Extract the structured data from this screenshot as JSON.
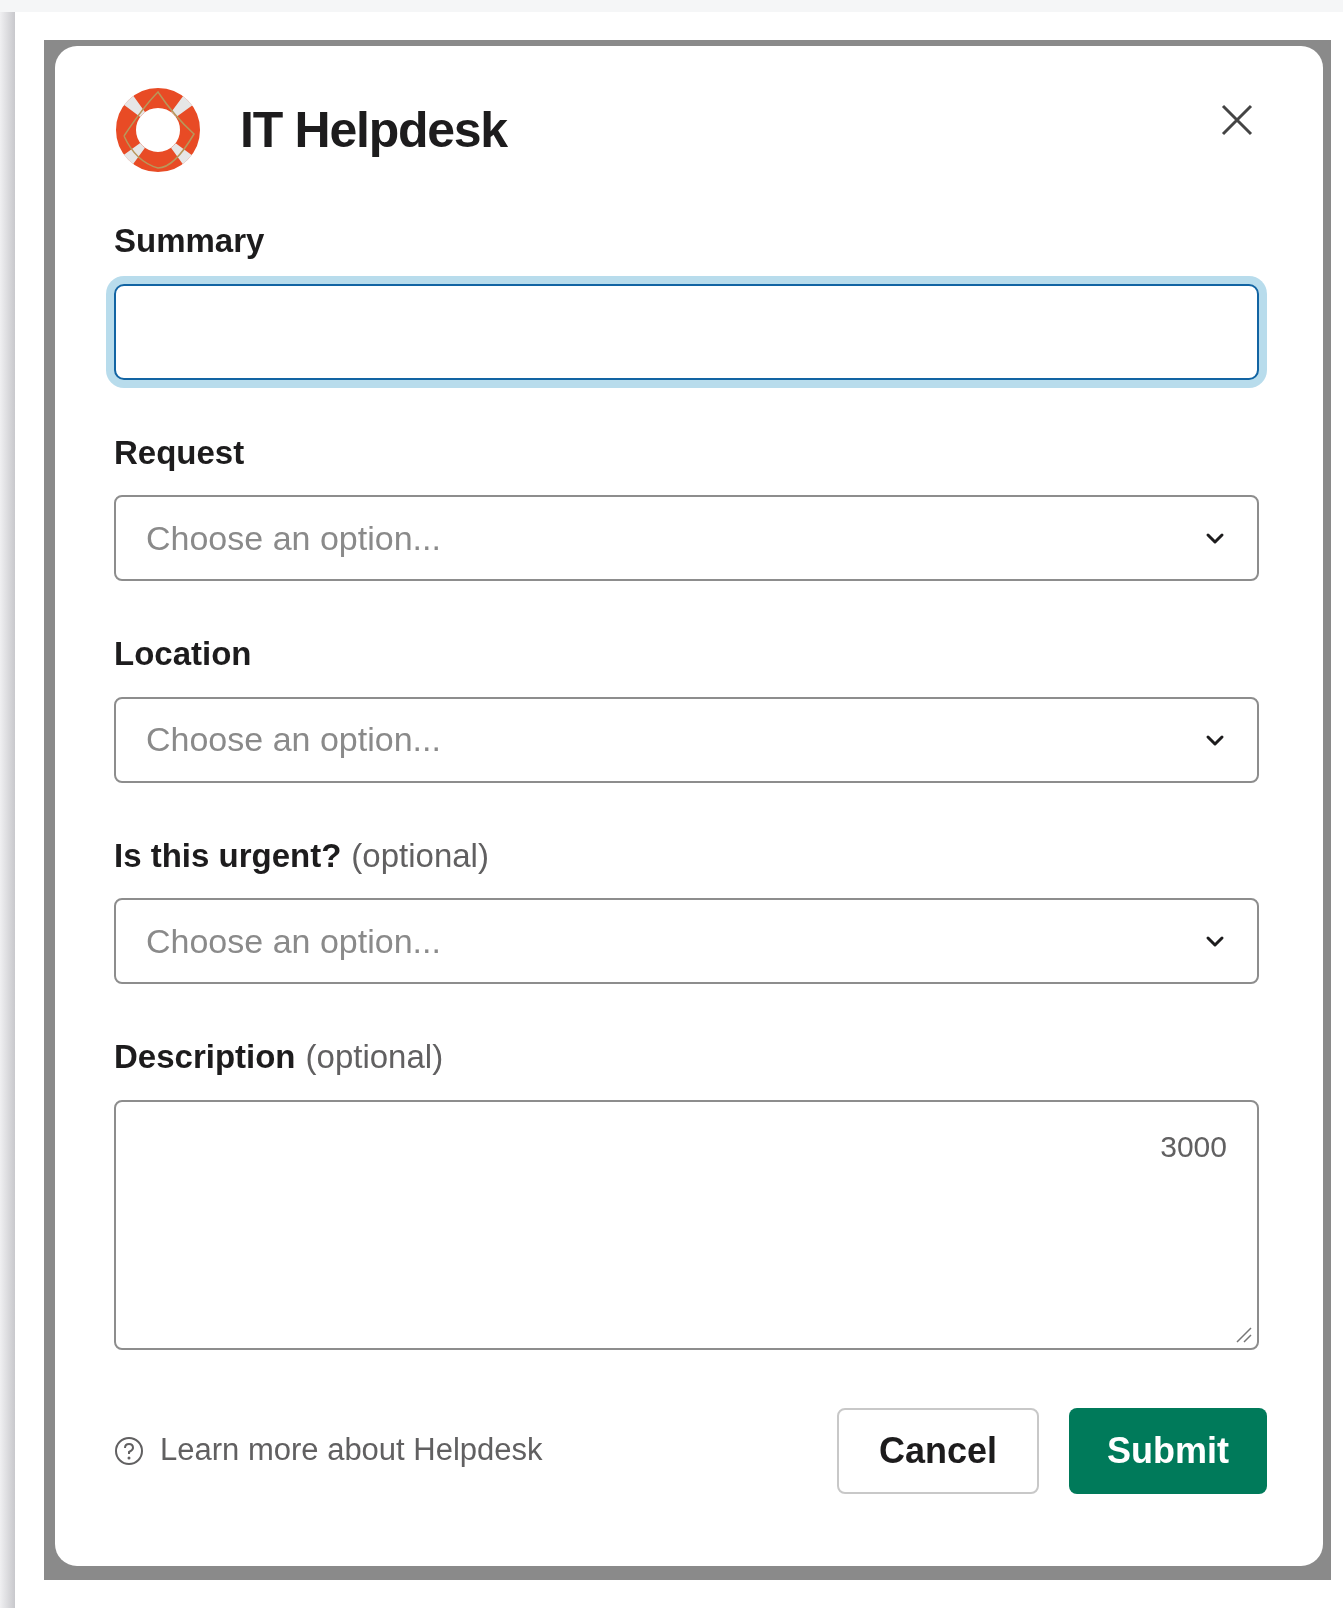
{
  "modal": {
    "title": "IT Helpdesk"
  },
  "fields": [
    {
      "kind": "text",
      "label": "Summary",
      "focused": true
    },
    {
      "kind": "select",
      "label": "Request",
      "placeholder": "Choose an option..."
    },
    {
      "kind": "select",
      "label": "Location",
      "placeholder": "Choose an option..."
    },
    {
      "kind": "select",
      "label": "Is this urgent?",
      "optional": "(optional)",
      "placeholder": "Choose an option..."
    },
    {
      "kind": "textarea",
      "label": "Description",
      "optional": "(optional)",
      "counter": "3000"
    }
  ],
  "footer": {
    "link": "Learn more about Helpdesk",
    "buttons": [
      {
        "label": "Cancel",
        "kind": "secondary"
      },
      {
        "label": "Submit",
        "kind": "primary"
      }
    ]
  }
}
